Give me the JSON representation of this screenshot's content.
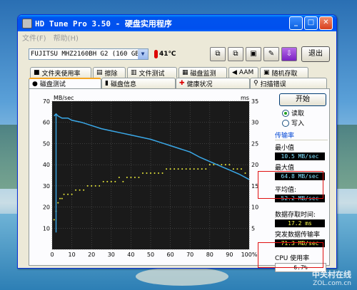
{
  "window": {
    "title": "HD Tune Pro 3.50 - 硬盘实用程序",
    "menu": [
      "文件(F)",
      "帮助(H)"
    ]
  },
  "toolbar": {
    "drive": "FUJITSU MHZ2160BH G2 (160 GB)",
    "temperature": "41℃",
    "exit_label": "退出"
  },
  "tabs_row1": [
    "文件夹使用率",
    "擦除",
    "文件测试",
    "磁盘监测",
    "AAM",
    "随机存取"
  ],
  "tabs_row2": [
    "磁盘测试",
    "磁盘信息",
    "健康状况",
    "扫描错误"
  ],
  "active_tab": "磁盘测试",
  "side": {
    "start_label": "开始",
    "read_label": "读取",
    "write_label": "写入",
    "transfer_title": "传输率",
    "min_label": "最小值",
    "min_value": "10.5 MB/sec",
    "max_label": "最大值",
    "max_value": "64.8 MB/sec",
    "avg_label": "平均值:",
    "avg_value": "52.2 MB/sec",
    "access_label": "数据存取时间:",
    "access_value": "17.2 ms",
    "burst_label": "突发数据传输率",
    "burst_value": "71.3 MB/sec",
    "cpu_label": "CPU 使用率",
    "cpu_value": "6.7%"
  },
  "watermark": {
    "main": "中关村在线",
    "sub": "ZOL.com.cn"
  },
  "colors": {
    "transfer_line": "#3aa8e8",
    "access_points": "#e8e83a",
    "chart_bg": "#1a1a1a",
    "highlight": "#e01010"
  },
  "chart_data": {
    "type": "line",
    "y_left_unit": "MB/sec",
    "y_right_unit": "ms",
    "ylim_left": [
      0,
      70
    ],
    "ylim_right": [
      0,
      35
    ],
    "y_left_ticks": [
      "70",
      "60",
      "50",
      "40",
      "30",
      "20",
      "10"
    ],
    "y_right_ticks": [
      "35",
      "30",
      "25",
      "20",
      "15",
      "10",
      "5"
    ],
    "x_ticks": [
      "0",
      "10",
      "20",
      "30",
      "40",
      "50",
      "60",
      "70",
      "80",
      "90",
      "100%"
    ],
    "grid": true,
    "series": [
      {
        "type": "line",
        "x": [
          1,
          2,
          3,
          5,
          8,
          10,
          15,
          20,
          25,
          30,
          35,
          40,
          45,
          50,
          55,
          60,
          65,
          70,
          75,
          80,
          85,
          90,
          95,
          100
        ],
        "values": [
          63,
          64,
          63,
          62,
          62,
          61,
          60,
          58.5,
          57,
          56,
          55,
          54,
          53,
          52,
          50.5,
          49,
          47.5,
          46,
          43.5,
          41.5,
          39.5,
          37.5,
          35.5,
          33
        ]
      },
      {
        "type": "scatter",
        "x": [
          1,
          2,
          3,
          4,
          5,
          6,
          8,
          10,
          12,
          14,
          16,
          18,
          20,
          22,
          24,
          26,
          28,
          30,
          32,
          34,
          36,
          38,
          40,
          42,
          44,
          46,
          48,
          50,
          52,
          54,
          56,
          58,
          60,
          62,
          64,
          66,
          68,
          70,
          72,
          74,
          76,
          78,
          80,
          82,
          84,
          86,
          88,
          90,
          92,
          94,
          96,
          98
        ],
        "values": [
          7,
          9,
          11,
          12,
          12,
          13,
          13,
          13,
          14,
          14,
          14,
          15,
          15,
          15,
          15,
          16,
          16,
          16,
          16,
          17,
          16,
          17,
          17,
          17,
          17,
          18,
          18,
          18,
          18,
          18,
          18,
          19,
          19,
          19,
          19,
          19,
          19,
          19,
          19,
          19,
          19,
          19,
          20,
          20,
          20,
          20,
          20,
          20,
          19,
          19,
          19,
          18
        ]
      }
    ]
  }
}
